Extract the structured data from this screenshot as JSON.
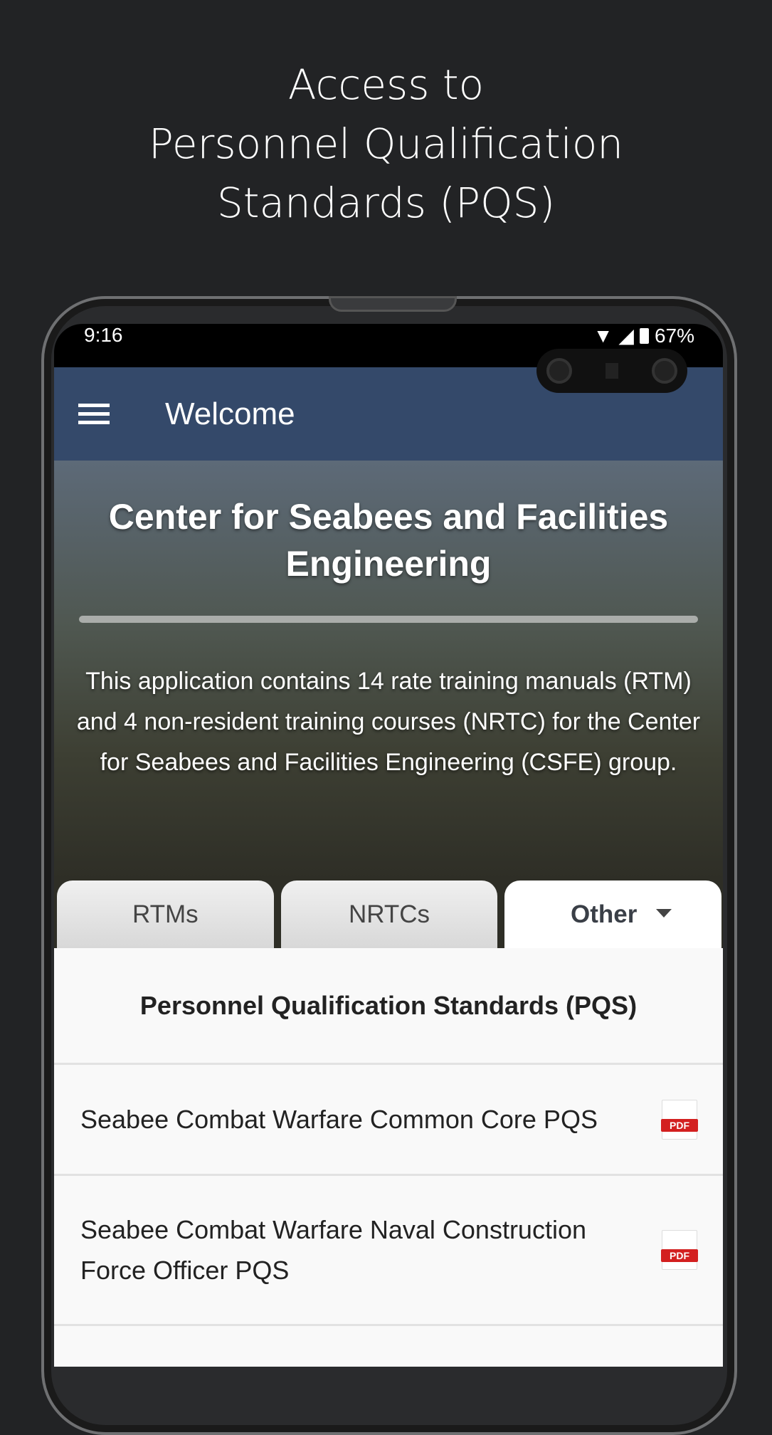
{
  "promo": {
    "line1": "Access to",
    "line2": "Personnel Qualification",
    "line3": "Standards (PQS)"
  },
  "status": {
    "time": "9:16",
    "battery": "67%"
  },
  "appbar": {
    "title": "Welcome"
  },
  "hero": {
    "title": "Center for Seabees and Facilities Engineering",
    "description": "This application contains 14 rate training manuals (RTM) and 4 non-resident training courses (NRTC) for the Center for Seabees and Facilities Engineering (CSFE) group."
  },
  "tabs": [
    {
      "label": "RTMs"
    },
    {
      "label": "NRTCs"
    },
    {
      "label": "Other",
      "active": true
    }
  ],
  "section": {
    "title": "Personnel Qualification Standards (PQS)"
  },
  "items": [
    {
      "label": "Seabee Combat Warfare Common Core PQS",
      "icon": "pdf-icon",
      "badge": "PDF"
    },
    {
      "label": "Seabee Combat Warfare Naval Construction Force Officer PQS",
      "icon": "pdf-icon",
      "badge": "PDF"
    }
  ]
}
